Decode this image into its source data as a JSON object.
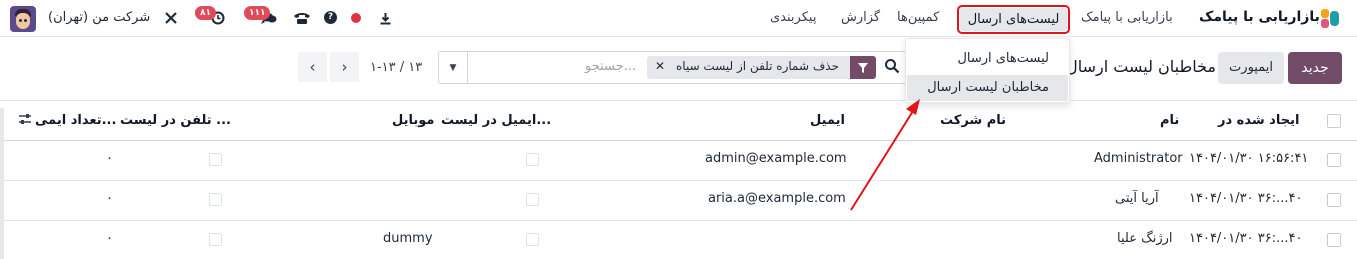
{
  "navbar": {
    "app_name": "بازاریابی با پیامک",
    "menu": [
      "بازاریابی با پیامک",
      "لیست‌های ارسال",
      "کمپین‌ها",
      "گزارش",
      "پیکربندی"
    ],
    "active_menu": "لیست‌های ارسال",
    "company": "شرکت من (تهران)",
    "badges": {
      "messages": "۱۱۱",
      "activities": "۸۱"
    },
    "icons": [
      "download-icon",
      "record-icon",
      "help-icon",
      "phone-icon",
      "chat-icon",
      "clock-icon",
      "debug-tools-icon"
    ]
  },
  "controls": {
    "new_label": "جدید",
    "import_label": "ایمپورت",
    "breadcrumb": "مخاطبان لیست ارسال",
    "search_placeholder": "جستجو...",
    "facet_label": "حذف شماره تلفن از لیست سیاه",
    "pager": "۱-۱۳ / ۱۳"
  },
  "dropdown": {
    "items": [
      "لیست‌های ارسال",
      "مخاطبان لیست ارسال"
    ],
    "highlighted": "مخاطبان لیست ارسال"
  },
  "table": {
    "columns": [
      "ایجاد شده در",
      "نام",
      "نام شرکت",
      "ایمیل",
      "ایمیل در لیست...",
      "موبایل",
      "تلفن در لیست ...",
      "تعداد ایمی..."
    ],
    "rows": [
      {
        "created": "۱۴۰۴/۰۱/۳۰ ۱۶:۵۶:۴۱",
        "name": "Administrator",
        "company": "",
        "email": "admin@example.com",
        "mobile": "",
        "count": "۰"
      },
      {
        "created": "۱۴۰۴/۰۱/۳۰ ۳۶:...۴۰",
        "name": "آریا آیتی",
        "company": "",
        "email": "aria.a@example.com",
        "mobile": "",
        "count": "۰"
      },
      {
        "created": "۱۴۰۴/۰۱/۳۰ ۳۶:...۴۰",
        "name": "ارژنگ علیا",
        "company": "",
        "email": "",
        "mobile": "dummy",
        "count": "۰"
      }
    ]
  },
  "colors": {
    "brand": "#714b67",
    "highlight_border": "#e0141b",
    "badge": "#e14a57"
  }
}
